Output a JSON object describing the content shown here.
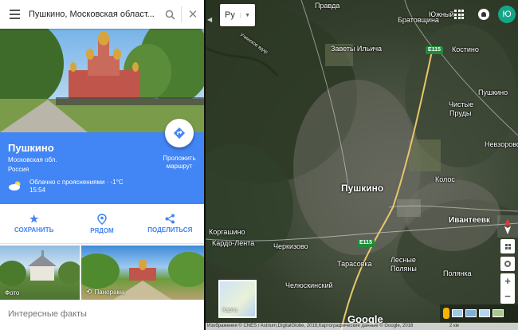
{
  "search": {
    "value": "Пушкино, Московская област..."
  },
  "language": {
    "value": "Ру"
  },
  "account": {
    "initial": "Ю"
  },
  "place": {
    "name": "Пушкино",
    "region": "Московская обл.",
    "country": "Россия",
    "weather": "Облачно с прояснениями · -1°C",
    "time": "15:54",
    "route_label_line1": "Проложить",
    "route_label_line2": "маршрут"
  },
  "actions": [
    {
      "label": "СОХРАНИТЬ",
      "icon": "star-icon"
    },
    {
      "label": "РЯДОМ",
      "icon": "nearby-icon"
    },
    {
      "label": "ПОДЕЛИТЬСЯ",
      "icon": "share-icon"
    }
  ],
  "photos": {
    "photo_label": "Фото",
    "panorama_label": "Панорама"
  },
  "facts_title": "Интересные факты",
  "map": {
    "labels": {
      "pravda": "Правда",
      "bratovshchina": "Братовщина",
      "yuzhny": "Южный",
      "zavety": "Заветы Ильича",
      "kostino": "Костино",
      "pushkino_top": "Пушкино",
      "chistye_prudy_1": "Чистые",
      "chistye_prudy_2": "Пруды",
      "nevzorovo": "Невзорово",
      "kolos": "Колос",
      "pushkino": "Пушкино",
      "ivanteevka": "Ивантеевк",
      "korgashino": "Коргашино",
      "kardo_lenta": "Кардо-Лента",
      "cherkizovo": "Черкизово",
      "tarasovka": "Тарасовка",
      "lesnye_1": "Лесные",
      "lesnye_2": "Поляны",
      "chelyuskinsky": "Челюскинский",
      "polyanka": "Полянка",
      "ucha": "Учинское вдхр",
      "e115": "E115"
    },
    "minimap_label": "Карта",
    "google": "Google",
    "attribution": "Изображения © CNES / Astrium,DigitalGlobe, 2016,Картографические данные © Google, 2016",
    "scale": "2 км"
  }
}
